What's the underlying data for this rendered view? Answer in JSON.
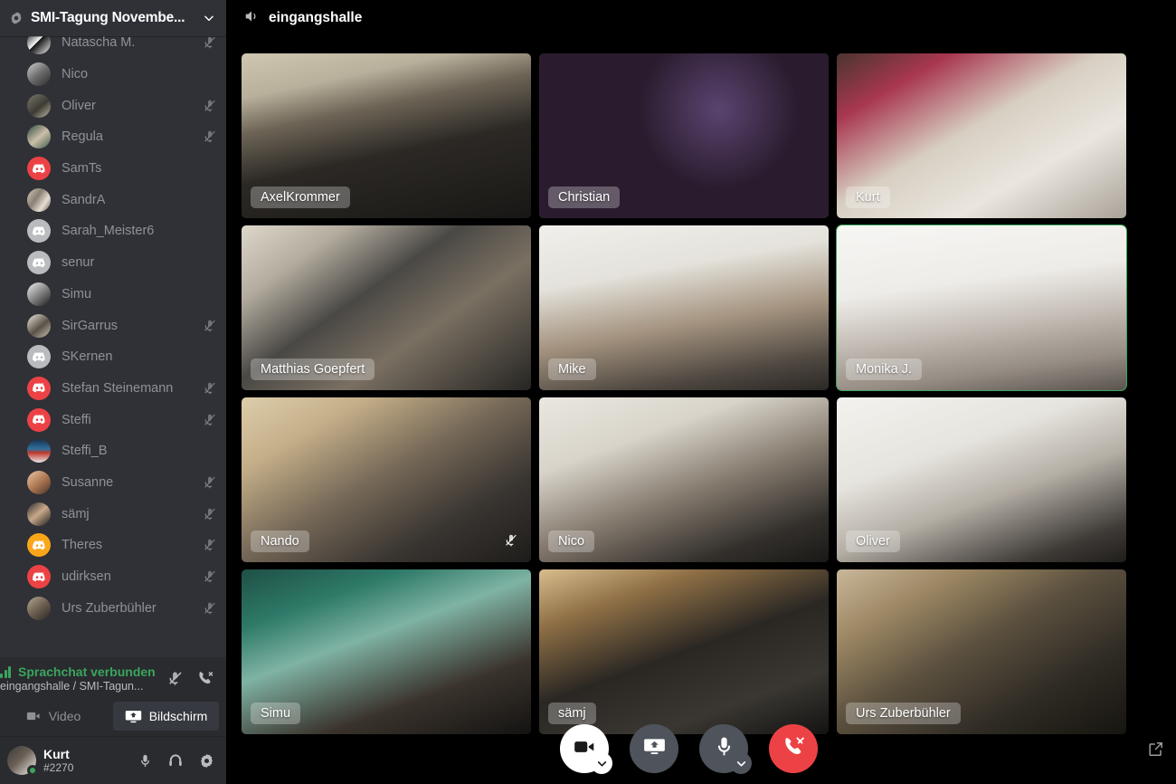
{
  "sidebar": {
    "channel_header": {
      "title": "SMI-Tagung Novembe...",
      "icon": "voice-channel-settings-icon",
      "chevron": "chevron-down-icon"
    },
    "members": [
      {
        "name": "Natascha M.",
        "muted": true,
        "avatar_kind": "photo",
        "color": "#f0f0f0",
        "photo": "dark-face"
      },
      {
        "name": "Nico",
        "muted": false,
        "avatar_kind": "photo",
        "color": "#9aa0a6",
        "photo": "gray-portrait"
      },
      {
        "name": "Oliver",
        "muted": true,
        "avatar_kind": "photo",
        "color": "#6b6f57",
        "photo": "man-room"
      },
      {
        "name": "Regula",
        "muted": true,
        "avatar_kind": "photo",
        "color": "#3c5b4d",
        "photo": "woman-green"
      },
      {
        "name": "SamTs",
        "muted": false,
        "avatar_kind": "default",
        "color": "#ed4245"
      },
      {
        "name": "SandrA",
        "muted": false,
        "avatar_kind": "photo",
        "color": "#bfae9b",
        "photo": "pattern"
      },
      {
        "name": "Sarah_Meister6",
        "muted": false,
        "avatar_kind": "default",
        "color": "#b9bbbe"
      },
      {
        "name": "senur",
        "muted": false,
        "avatar_kind": "default",
        "color": "#b9bbbe"
      },
      {
        "name": "Simu",
        "muted": false,
        "avatar_kind": "photo",
        "color": "#e8e8e8",
        "photo": "bw-man"
      },
      {
        "name": "SirGarrus",
        "muted": true,
        "avatar_kind": "photo",
        "color": "#e0ddd6",
        "photo": "figure"
      },
      {
        "name": "SKernen",
        "muted": false,
        "avatar_kind": "default",
        "color": "#b9bbbe"
      },
      {
        "name": "Stefan Steinemann",
        "muted": true,
        "avatar_kind": "default",
        "color": "#ed4245"
      },
      {
        "name": "Steffi",
        "muted": true,
        "avatar_kind": "default",
        "color": "#ed4245"
      },
      {
        "name": "Steffi_B",
        "muted": false,
        "avatar_kind": "photo",
        "color": "#2f6f9e",
        "photo": "mountain"
      },
      {
        "name": "Susanne",
        "muted": true,
        "avatar_kind": "photo",
        "color": "#c98a6a",
        "photo": "woman-face"
      },
      {
        "name": "sämj",
        "muted": true,
        "avatar_kind": "photo",
        "color": "#4a4a4a",
        "photo": "bearded"
      },
      {
        "name": "Theres",
        "muted": true,
        "avatar_kind": "default",
        "color": "#faa61a"
      },
      {
        "name": "udirksen",
        "muted": true,
        "avatar_kind": "default",
        "color": "#ed4245"
      },
      {
        "name": "Urs Zuberbühler",
        "muted": true,
        "avatar_kind": "photo",
        "color": "#8c8175",
        "photo": "man-sleep"
      }
    ],
    "voice_panel": {
      "status": "Sprachchat verbunden",
      "route": "eingangshalle / SMI-Tagun...",
      "signal_icon": "signal-strength-icon",
      "noise_icon": "noise-suppression-icon",
      "disconnect_icon": "disconnect-call-icon",
      "video_button": {
        "label": "Video",
        "icon": "video-camera-icon",
        "active": false
      },
      "screen_button": {
        "label": "Bildschirm",
        "icon": "screen-share-icon",
        "active": true
      }
    },
    "user_bar": {
      "name": "Kurt",
      "tag": "#2270",
      "status": "online",
      "status_color": "#3ba55d",
      "icons": [
        "microphone-icon",
        "headphones-icon",
        "gear-icon"
      ]
    }
  },
  "main": {
    "header": {
      "title": "eingangshalle",
      "icon": "speaker-volume-icon"
    },
    "tiles": [
      {
        "name": "AxelKrommer",
        "speaking": false,
        "muted": false,
        "bg": "linear-gradient(160deg,#c8c0ac 0%,#b6ae99 22%,#2d2a26 46%,#141311 100%)"
      },
      {
        "name": "Christian",
        "speaking": false,
        "muted": false,
        "bg": "linear-gradient(120deg,#1b1320 0%,#3a2336 18%,#8f2f58 34%,#3b3f73 56%,#6b2433 78%,#1a1014 100%)"
      },
      {
        "name": "Kurt",
        "speaking": false,
        "muted": false,
        "bg": "linear-gradient(150deg,#5c4238 0%,#8f3a4e 26%,#cfc8bd 55%,#e8e4dd 78%,#b5aea4 100%)"
      },
      {
        "name": "Matthias Goepfert",
        "speaking": false,
        "muted": false,
        "bg": "linear-gradient(140deg,#d8d2c6 0%,#a8a195 24%,#3b3a38 48%,#6d6457 72%,#232221 100%)"
      },
      {
        "name": "Mike",
        "speaking": false,
        "muted": false,
        "bg": "linear-gradient(160deg,#efeeea 0%,#e2e0da 34%,#9a897a 60%,#4d4640 85%,#2a2724 100%)"
      },
      {
        "name": "Monika J.",
        "speaking": true,
        "muted": false,
        "bg": "linear-gradient(165deg,#f4f4f2 0%,#eceae6 38%,#b9b2aa 62%,#8e857d 82%,#55504b 100%)"
      },
      {
        "name": "Nando",
        "speaking": false,
        "muted": true,
        "bg": "linear-gradient(150deg,#d9c9a8 0%,#c2ac86 26%,#6d6154 52%,#33302c 78%,#1c1a18 100%)"
      },
      {
        "name": "Nico",
        "speaking": false,
        "muted": false,
        "bg": "linear-gradient(150deg,#e8e5de 0%,#d6d2c8 30%,#7c756c 58%,#2e2b28 82%,#17incorrect)"
      },
      {
        "name": "Oliver",
        "speaking": false,
        "muted": false,
        "bg": "linear-gradient(150deg,#f2f1ed 0%,#e4e2dc 36%,#b0aaa1 60%,#3a3733 85%,#1d1b19 100%)"
      }
    ],
    "tiles_row4": [
      {
        "name": "Simu",
        "speaking": false,
        "muted": false
      },
      {
        "name": "sämj",
        "speaking": false,
        "muted": false
      },
      {
        "name": "Urs Zuberbühler",
        "speaking": false,
        "muted": false
      }
    ],
    "controls": [
      {
        "name": "camera-button",
        "icon": "video-camera-icon",
        "style": "light",
        "caret": true
      },
      {
        "name": "screenshare-button",
        "icon": "screen-share-icon",
        "style": "dark",
        "caret": false
      },
      {
        "name": "microphone-button",
        "icon": "microphone-icon",
        "style": "dark",
        "caret": true
      },
      {
        "name": "hangup-button",
        "icon": "disconnect-call-icon",
        "style": "hang",
        "caret": false
      }
    ],
    "popout_icon": "popout-fullscreen-icon"
  },
  "colors": {
    "sidebar_bg": "#2f3136",
    "panel_bg": "#292b2f",
    "stage_bg": "#000000",
    "accent_green": "#3ba55d",
    "danger_red": "#ed4245",
    "text_muted": "#8e9297"
  }
}
